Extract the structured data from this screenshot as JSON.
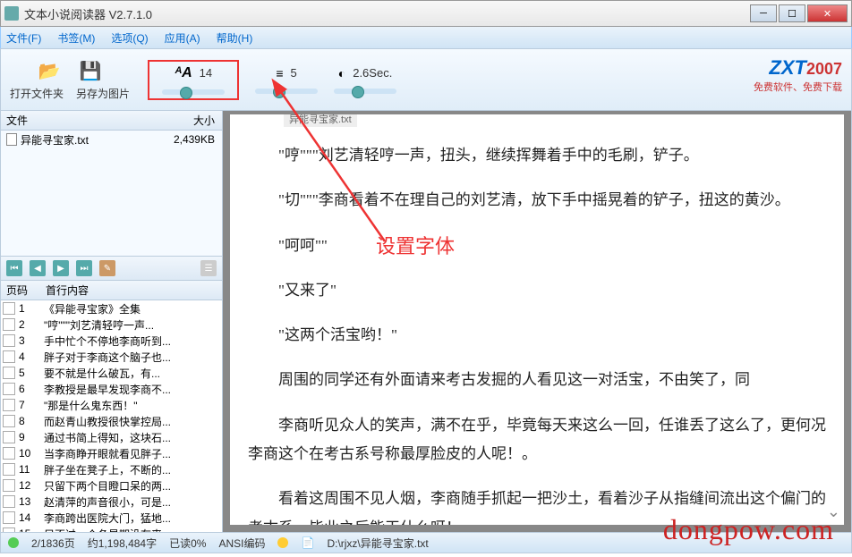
{
  "window": {
    "title": "文本小说阅读器 V2.7.1.0"
  },
  "menu": {
    "file": "文件(F)",
    "bookmark": "书签(M)",
    "options": "选项(Q)",
    "app": "应用(A)",
    "help": "帮助(H)"
  },
  "toolbar": {
    "open_folder": "打开文件夹",
    "save_image": "另存为图片",
    "font_size": "14",
    "line_spacing": "5",
    "speed": "2.6Sec.",
    "logo_main": "ZXT",
    "logo_year": "2007",
    "logo_sub": "免费软件、免费下载"
  },
  "sidebar": {
    "file_col1": "文件",
    "file_col2": "大小",
    "files": [
      {
        "name": "异能寻宝家.txt",
        "size": "2,439KB"
      }
    ],
    "page_col1": "页码",
    "page_col2": "首行内容",
    "pages": [
      {
        "n": "1",
        "t": "《异能寻宝家》全集"
      },
      {
        "n": "2",
        "t": "\"哼\"\"\"刘艺清轻哼一声..."
      },
      {
        "n": "3",
        "t": "手中忙个不停地李商听到..."
      },
      {
        "n": "4",
        "t": "胖子对于李商这个脑子也..."
      },
      {
        "n": "5",
        "t": "要不就是什么破瓦，有..."
      },
      {
        "n": "6",
        "t": "李教授是最早发现李商不..."
      },
      {
        "n": "7",
        "t": "\"那是什么鬼东西！\""
      },
      {
        "n": "8",
        "t": "而赵青山教授很快掌控局..."
      },
      {
        "n": "9",
        "t": "通过书简上得知，这块石..."
      },
      {
        "n": "10",
        "t": "当李商睁开眼就看见胖子..."
      },
      {
        "n": "11",
        "t": "胖子坐在凳子上，不断的..."
      },
      {
        "n": "12",
        "t": "只留下两个目瞪口呆的两..."
      },
      {
        "n": "13",
        "t": "赵清萍的声音很小，可是..."
      },
      {
        "n": "14",
        "t": "李商跨出医院大门，猛地..."
      },
      {
        "n": "15",
        "t": "只不过一个冬星期没有来..."
      }
    ]
  },
  "reader": {
    "tab": "异能寻宝家.txt",
    "lines": [
      "\"哼\"\"\"刘艺清轻哼一声，扭头，继续挥舞着手中的毛刷，铲子。",
      "\"切\"\"\"李商看着不在理自己的刘艺清，放下手中摇晃着的铲子，扭这的黄沙。",
      "\"呵呵\"\"",
      "\"又来了\"",
      "\"这两个活宝哟！\"",
      "周围的同学还有外面请来考古发掘的人看见这一对活宝，不由笑了，同",
      "李商听见众人的笑声，满不在乎，毕竟每天来这么一回，任谁丢了这么了，更何况李商这个在考古系号称最厚脸皮的人呢！。",
      "看着这周围不见人烟，李商随手抓起一把沙土，看着沙子从指缝间流出这个偏门的考古系，毕业之后能干什么呀！。"
    ]
  },
  "annotation": {
    "label": "设置字体"
  },
  "status": {
    "pages": "2/1836页",
    "chars": "约1,198,484字",
    "read": "已读0%",
    "encoding": "ANSI编码",
    "path": "D:\\rjxz\\异能寻宝家.txt"
  },
  "watermark": "dongpow.com"
}
